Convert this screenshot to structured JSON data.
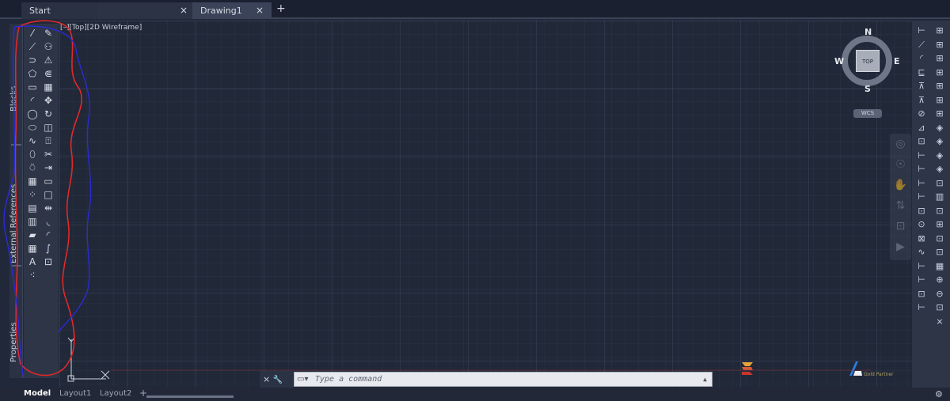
{
  "tabs": {
    "start": "Start",
    "drawing": "Drawing1",
    "close": "×",
    "add": "+"
  },
  "viewport": {
    "label": "[–][Top][2D Wireframe]"
  },
  "palettes": {
    "blocks": "Blocks",
    "external_references": "External References",
    "properties": "Properties"
  },
  "left_tools": {
    "draw": [
      "⁄",
      "⟋",
      "⊃",
      "⬠",
      "▭",
      "◜",
      "◯",
      "⬭",
      "∿",
      "⬯",
      "⍥",
      "▦",
      "⁘",
      "▤",
      "▥",
      "▰",
      "▦",
      "A",
      "⁖"
    ],
    "modify": [
      "✎",
      "⚇",
      "⚠",
      "⋐",
      "▦",
      "✥",
      "↻",
      "◫",
      "⍐",
      "✂",
      "⇥",
      "▭",
      "□",
      "⇹",
      "◟",
      "◜",
      "∫",
      "⊡"
    ]
  },
  "viewcube": {
    "north": "N",
    "south": "S",
    "west": "W",
    "east": "E",
    "top": "TOP",
    "wcs": "WCS"
  },
  "nav_tools": [
    "◎",
    "☉",
    "✋",
    "⇅",
    "⊡",
    "▶"
  ],
  "right_tools": {
    "col1": [
      "⊢",
      "⟋",
      "◜",
      "⊑",
      "⊼",
      "⊼",
      "⊘",
      "⊿",
      "⊡",
      "⊢",
      "⊢",
      "⊢",
      "⊢",
      "⊡",
      "⊙",
      "⊠",
      "∿",
      "⊢",
      "⊢",
      "⊡",
      "⊢"
    ],
    "col2": [
      "⊞",
      "⊞",
      "⊞",
      "⊞",
      "⊞",
      "⊞",
      "⊞",
      "◈",
      "◈",
      "◈",
      "◈",
      "⊡",
      "▥",
      "⊡",
      "⊞",
      "⊡",
      "⊡",
      "▦",
      "⊕",
      "⊖",
      "⊡",
      "⨯"
    ]
  },
  "command_line": {
    "close": "×",
    "wrench": "🔧",
    "placeholder": "Type a command",
    "caret": "▲"
  },
  "branding": {
    "partner": "Gold Partner"
  },
  "layout_tabs": {
    "model": "Model",
    "layout1": "Layout1",
    "layout2": "Layout2",
    "add": "+"
  },
  "annotation_colors": {
    "red": "#e0292a",
    "blue": "#2b2bd8"
  }
}
